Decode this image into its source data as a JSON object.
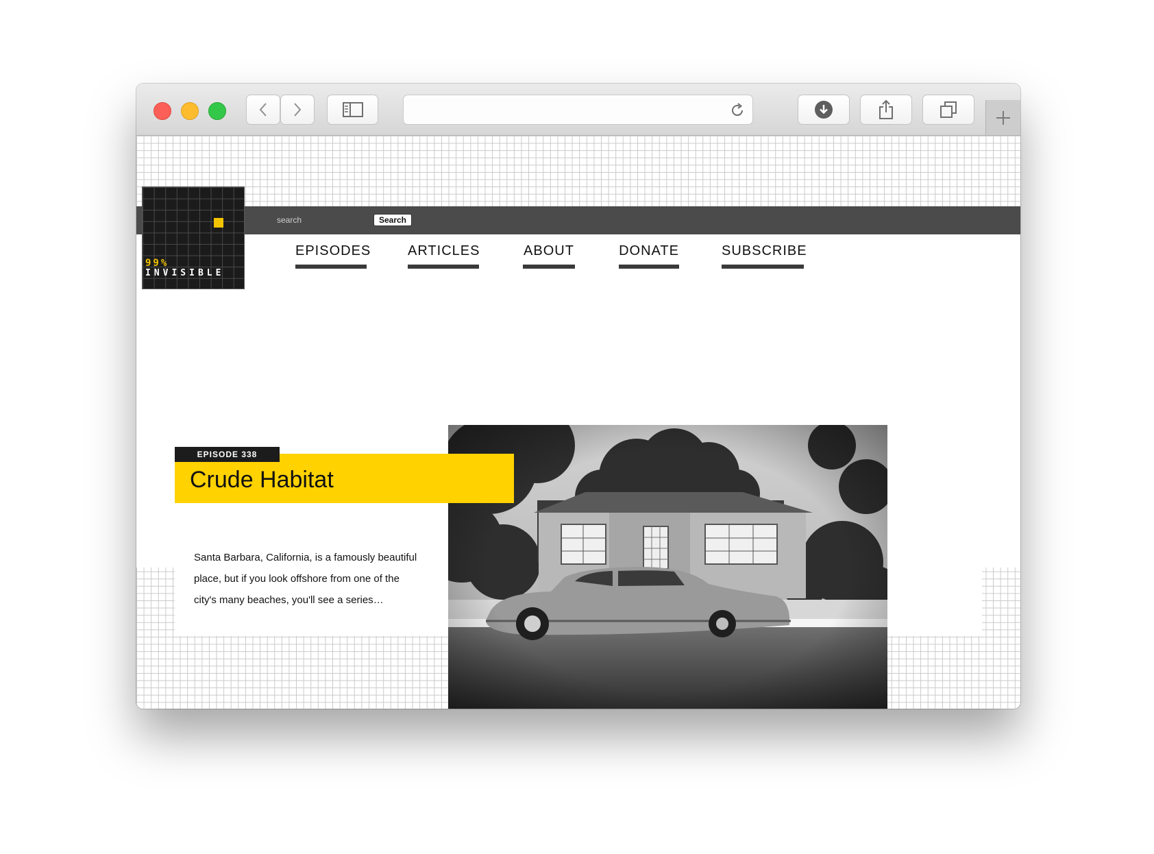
{
  "browser": {
    "window_controls": [
      "close",
      "minimize",
      "zoom"
    ],
    "icons": {
      "back": "chevron-left-icon",
      "forward": "chevron-right-icon",
      "sidebar": "sidebar-icon",
      "reload": "reload-icon",
      "download": "download-icon",
      "share": "share-icon",
      "tabs": "tabs-icon",
      "new_tab": "plus-icon"
    },
    "address": ""
  },
  "site": {
    "logo": {
      "percent": "99%",
      "word": "INVISIBLE"
    },
    "search": {
      "placeholder": "search",
      "button_label": "Search"
    },
    "nav": [
      "EPISODES",
      "ARTICLES",
      "ABOUT",
      "DONATE",
      "SUBSCRIBE"
    ],
    "featured": {
      "tag": "EPISODE 338",
      "title": "Crude Habitat",
      "excerpt": "Santa Barbara, California, is a famously beautiful place, but if you look offshore from one of the city's many beaches, you'll see a series…"
    }
  },
  "colors": {
    "accent_yellow": "#ffd200",
    "bar_dark": "#4b4b4b",
    "logo_bg": "#1b1b1b"
  }
}
